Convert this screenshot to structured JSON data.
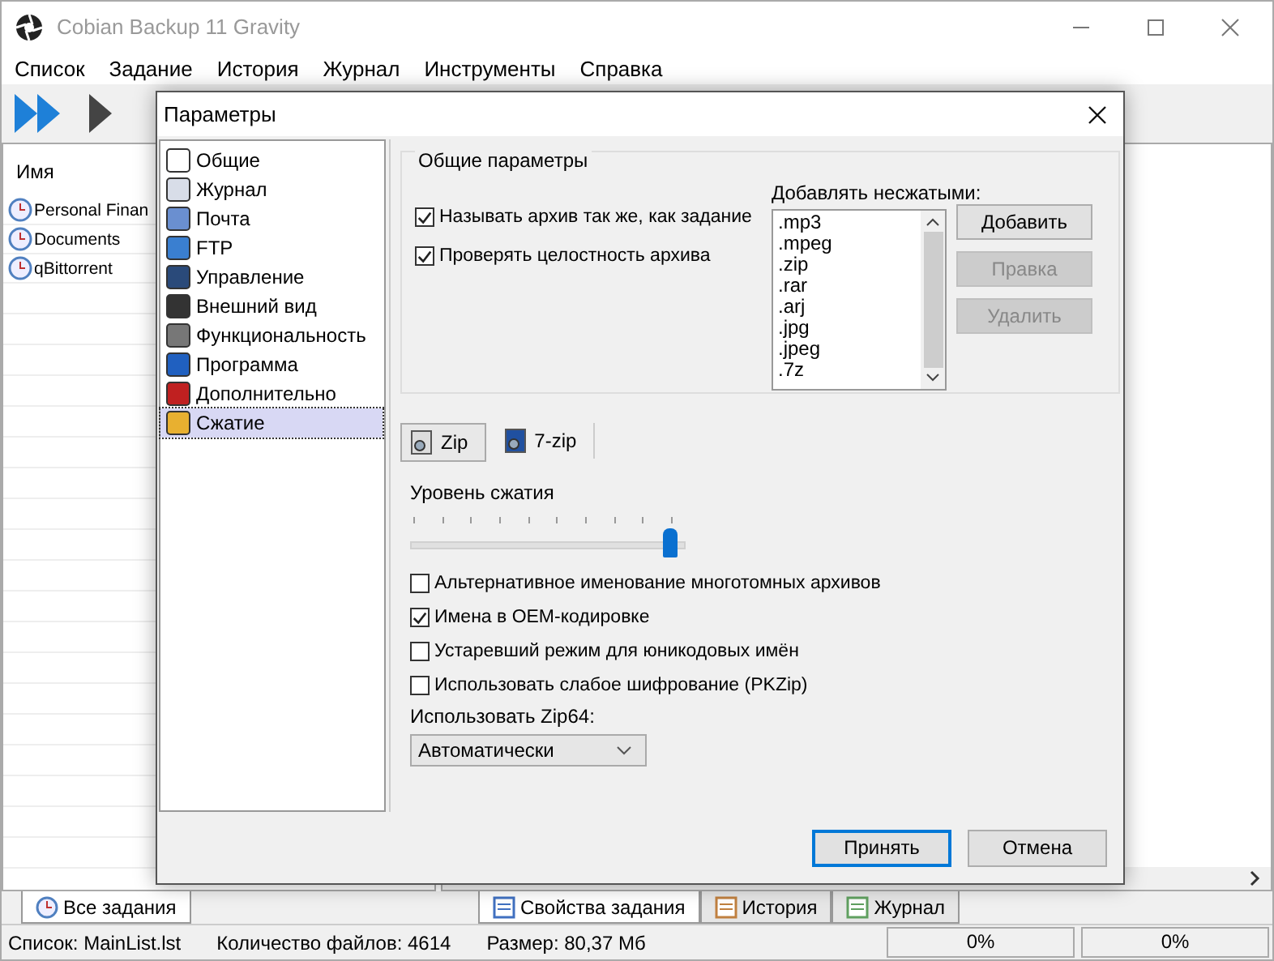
{
  "window": {
    "title": "Cobian Backup 11 Gravity"
  },
  "menu": [
    "Список",
    "Задание",
    "История",
    "Журнал",
    "Инструменты",
    "Справка"
  ],
  "task_list": {
    "header": "Имя",
    "items": [
      {
        "name": "Personal Finan"
      },
      {
        "name": "Documents"
      },
      {
        "name": "qBittorrent"
      }
    ]
  },
  "left_tabs": [
    {
      "label": "Все задания",
      "selected": true
    }
  ],
  "right_tabs": [
    {
      "label": "Свойства задания",
      "kind": "properties",
      "selected": true
    },
    {
      "label": "История",
      "kind": "history",
      "selected": false
    },
    {
      "label": "Журнал",
      "kind": "log",
      "selected": false
    }
  ],
  "status_bar": {
    "list": "Список: MainList.lst",
    "files": "Количество файлов: 4614",
    "size": "Размер: 80,37 Мб",
    "progress": [
      "0%",
      "0%"
    ]
  },
  "dialog": {
    "title": "Параметры",
    "categories": [
      {
        "label": "Общие",
        "kind": "general",
        "selected": false
      },
      {
        "label": "Журнал",
        "kind": "log",
        "selected": false
      },
      {
        "label": "Почта",
        "kind": "mail",
        "selected": false
      },
      {
        "label": "FTP",
        "kind": "ftp",
        "selected": false
      },
      {
        "label": "Управление",
        "kind": "control",
        "selected": false
      },
      {
        "label": "Внешний вид",
        "kind": "appearance",
        "selected": false
      },
      {
        "label": "Функциональность",
        "kind": "functions",
        "selected": false
      },
      {
        "label": "Программа",
        "kind": "program",
        "selected": false
      },
      {
        "label": "Дополнительно",
        "kind": "advanced",
        "selected": false
      },
      {
        "label": "Сжатие",
        "kind": "compression",
        "selected": true
      }
    ],
    "group": {
      "title": "Общие параметры",
      "options": [
        {
          "label": "Называть архив так же, как задание",
          "checked": true
        },
        {
          "label": "Проверять целостность архива",
          "checked": true
        }
      ],
      "uncompressed_label": "Добавлять несжатыми:",
      "extensions": [
        ".mp3",
        ".mpeg",
        ".zip",
        ".rar",
        ".arj",
        ".jpg",
        ".jpeg",
        ".7z"
      ],
      "buttons": [
        {
          "label": "Добавить",
          "disabled": false
        },
        {
          "label": "Правка",
          "disabled": true
        },
        {
          "label": "Удалить",
          "disabled": true
        }
      ]
    },
    "tabs": [
      {
        "label": "Zip",
        "selected": true
      },
      {
        "label": "7-zip",
        "selected": false
      }
    ],
    "slider": {
      "label": "Уровень сжатия",
      "level": 1
    },
    "options": [
      {
        "label": "Альтернативное именование многотомных архивов",
        "checked": false
      },
      {
        "label": "Имена в OEM-кодировке",
        "checked": true
      },
      {
        "label": "Устаревший режим для юникодовых имён",
        "checked": false
      },
      {
        "label": "Использовать слабое шифрование (PKZip)",
        "checked": false
      }
    ],
    "zip64": {
      "label": "Использовать Zip64:",
      "value": "Автоматически"
    },
    "buttons": [
      {
        "label": "Принять",
        "default": true
      },
      {
        "label": "Отмена",
        "default": false
      }
    ]
  }
}
